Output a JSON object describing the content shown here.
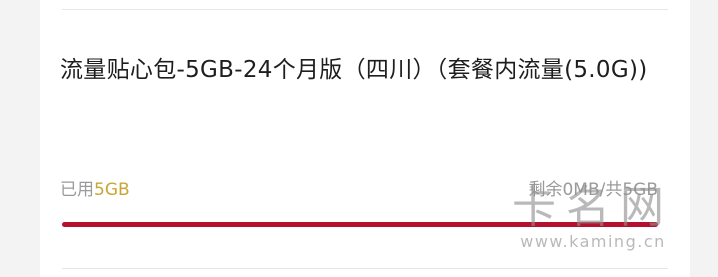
{
  "package": {
    "title": "流量贴心包-5GB-24个月版（四川）（套餐内流量(5.0G))",
    "used_label": "已用",
    "used_amount": "5GB",
    "remaining_text": "剩余0MB/共5GB",
    "usage_fraction": 1.0
  },
  "colors": {
    "accent_used": "#c9a634",
    "progress_fill": "#b5102e"
  },
  "watermark": {
    "logo": "卡名网",
    "url": "www.kaming.cn"
  }
}
